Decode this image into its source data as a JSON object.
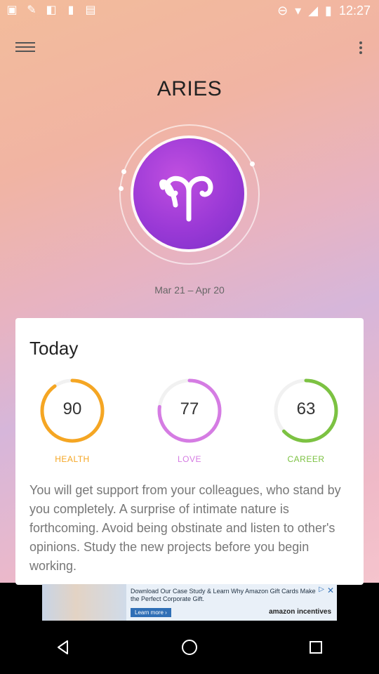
{
  "header": {
    "title": "ARIES",
    "date_range": "Mar 21 – Apr 20"
  },
  "status_bar": {
    "time": "12:27"
  },
  "card": {
    "title": "Today",
    "metrics": [
      {
        "label": "HEALTH",
        "value": "90",
        "color": "#f5a623"
      },
      {
        "label": "LOVE",
        "value": "77",
        "color": "#d57ce3"
      },
      {
        "label": "CAREER",
        "value": "63",
        "color": "#7cc242"
      }
    ],
    "text": "You will get support from your colleagues, who stand by you completely. A surprise of intimate nature is forthcoming. Avoid being obstinate and listen to other's opinions. Study the new projects before you begin working."
  },
  "ad": {
    "headline": "Download Our Case Study & Learn Why Amazon Gift Cards Make the Perfect Corporate Gift.",
    "cta": "Learn more ›",
    "brand": "amazon incentives"
  },
  "icons": {
    "menu": "menu-icon",
    "more": "more-vert-icon",
    "zodiac": "aries-symbol-icon"
  }
}
